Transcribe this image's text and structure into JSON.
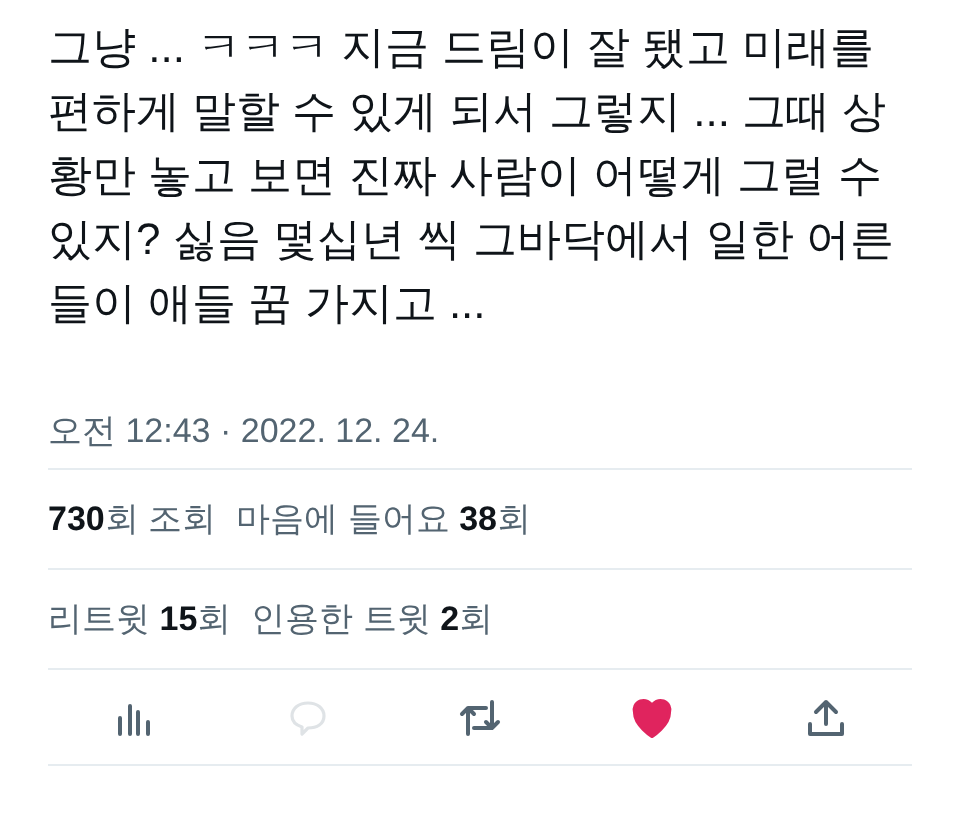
{
  "tweet": {
    "body_lines": [
      "그냥 ... ㅋㅋㅋ 지금 드림이 잘 됐고 미래를",
      "편하게 말할 수 있게 되서 그렇지 ... 그때 상",
      "황만 놓고 보면 진짜 사람이 어떻게 그럴 수",
      "있지? 싫음 몇십년 씩 그바닥에서 일한 어른",
      "들이 애들 꿈 가지고 ..."
    ],
    "timestamp": "오전 12:43 · 2022. 12. 24.",
    "stat_rows": [
      [
        "**730**회 조회",
        "마음에 들어요 **38**회"
      ],
      [
        "리트윗 **15**회",
        "인용한 트윗 **2**회"
      ]
    ],
    "actions": [
      {
        "kind": "analytics",
        "disabled": false,
        "selected": false
      },
      {
        "kind": "reply",
        "disabled": true,
        "selected": false
      },
      {
        "kind": "retweet",
        "disabled": false,
        "selected": false
      },
      {
        "kind": "like",
        "disabled": false,
        "selected": true
      },
      {
        "kind": "share",
        "disabled": false,
        "selected": false
      }
    ]
  }
}
